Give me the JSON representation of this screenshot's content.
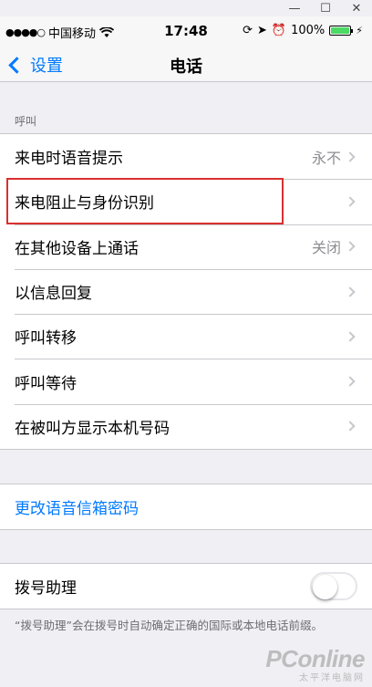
{
  "window": {
    "minimize": "—",
    "maximize": "☐",
    "close": "✕"
  },
  "status_bar": {
    "signal": "●●●●○",
    "carrier": "中国移动",
    "wifi": "wifi-icon",
    "time": "17:48",
    "rotation_lock": "⟳",
    "location": "➤",
    "alarm": "⏰",
    "battery_percent": "100%",
    "battery_level": 1.0,
    "charging": "⚡"
  },
  "nav": {
    "back_label": "设置",
    "title": "电话"
  },
  "section_call": {
    "header": "呼叫",
    "rows": [
      {
        "label": "来电时语音提示",
        "value": "永不"
      },
      {
        "label": "来电阻止与身份识别",
        "value": ""
      },
      {
        "label": "在其他设备上通话",
        "value": "关闭"
      },
      {
        "label": "以信息回复",
        "value": ""
      },
      {
        "label": "呼叫转移",
        "value": ""
      },
      {
        "label": "呼叫等待",
        "value": ""
      },
      {
        "label": "在被叫方显示本机号码",
        "value": ""
      }
    ]
  },
  "voicemail": {
    "label": "更改语音信箱密码"
  },
  "dial_assist": {
    "label": "拨号助理",
    "enabled": false,
    "note": "“拨号助理”会在拨号时自动确定正确的国际或本地电话前缀。"
  },
  "colors": {
    "accent": "#007aff",
    "highlight": "#d8302f",
    "background": "#efeff4"
  },
  "watermark": {
    "main": "PConline",
    "sub": "太平洋电脑网"
  }
}
